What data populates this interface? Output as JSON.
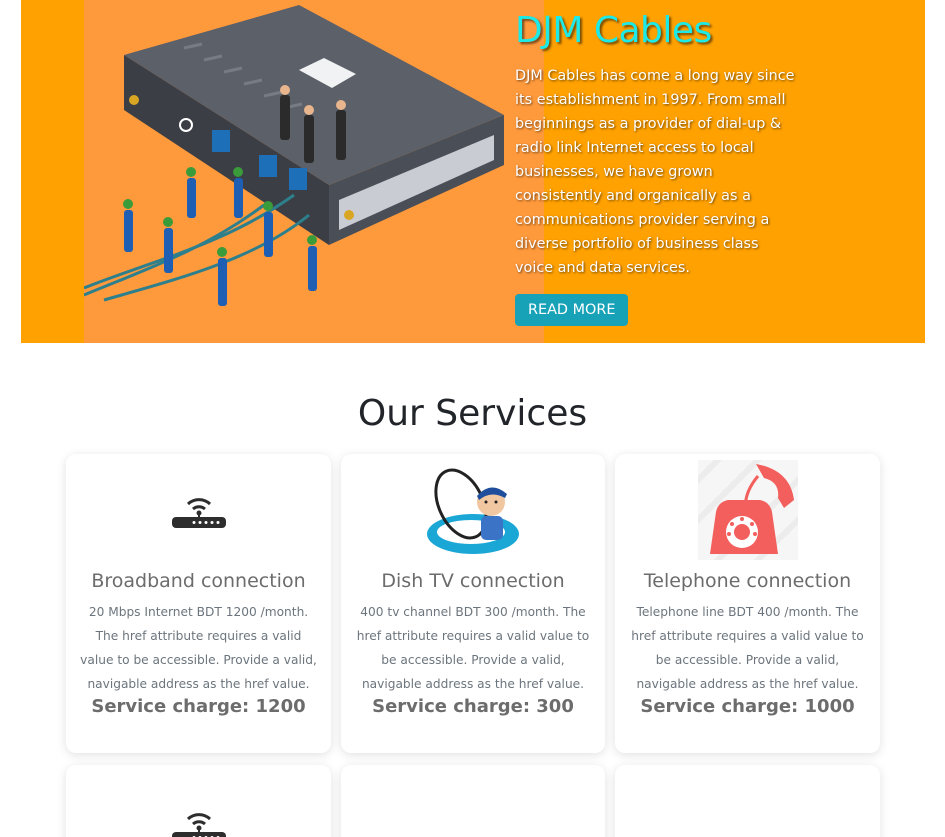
{
  "hero": {
    "title": "DJM Cables",
    "description": "DJM Cables has come a long way since its establishment in 1997. From small beginnings as a provider of dial-up & radio link Internet access to local businesses, we have grown consistently and organically as a communications provider serving a diverse portfolio of business class voice and data services.",
    "button_label": "READ MORE",
    "colors": {
      "background": "#ffa100",
      "title": "#1de9e6",
      "button": "#17a2b8"
    }
  },
  "services": {
    "title": "Our Services",
    "cards": [
      {
        "icon": "router-icon",
        "title": "Broadband connection",
        "description": "20 Mbps Internet BDT 1200 /month. The href attribute requires a valid value to be accessible. Provide a valid, navigable address as the href value.",
        "charge": "Service charge: 1200"
      },
      {
        "icon": "satellite-dish-icon",
        "title": "Dish TV connection",
        "description": "400 tv channel BDT 300 /month. The href attribute requires a valid value to be accessible. Provide a valid, navigable address as the href value.",
        "charge": "Service charge: 300"
      },
      {
        "icon": "telephone-icon",
        "title": "Telephone connection",
        "description": "Telephone line BDT 400 /month. The href attribute requires a valid value to be accessible. Provide a valid, navigable address as the href value.",
        "charge": "Service charge: 1000"
      }
    ]
  }
}
